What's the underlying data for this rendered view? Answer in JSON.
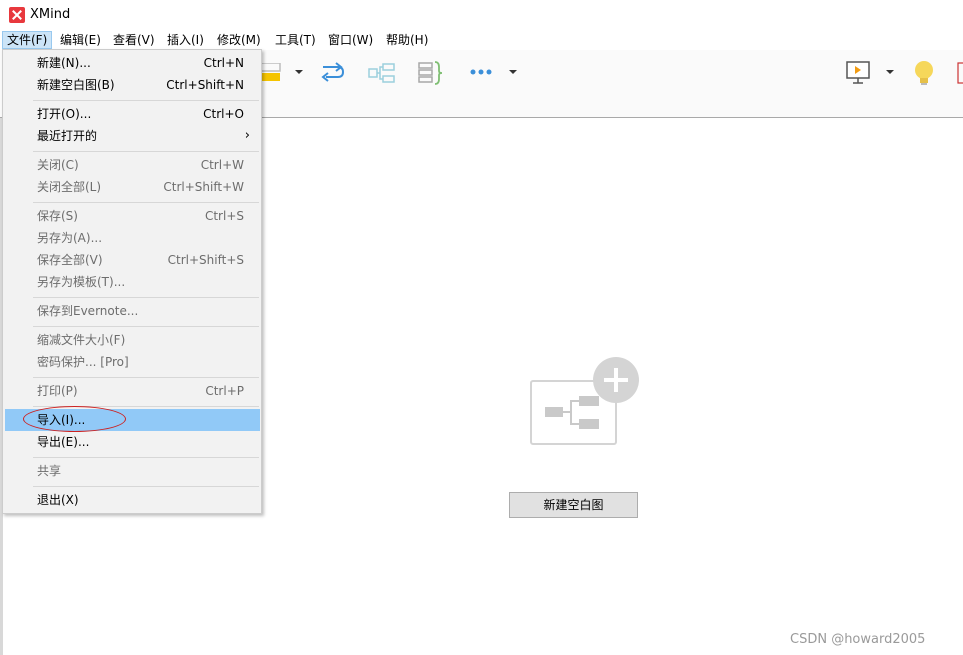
{
  "window": {
    "title": "XMind"
  },
  "menubar": [
    "文件(F)",
    "编辑(E)",
    "查看(V)",
    "插入(I)",
    "修改(M)",
    "工具(T)",
    "窗口(W)",
    "帮助(H)"
  ],
  "file_menu": {
    "items": [
      {
        "label": "新建(N)...",
        "shortcut": "Ctrl+N",
        "enabled": true
      },
      {
        "label": "新建空白图(B)",
        "shortcut": "Ctrl+Shift+N",
        "enabled": true
      },
      {
        "label": "打开(O)...",
        "shortcut": "Ctrl+O",
        "enabled": true
      },
      {
        "label": "最近打开的",
        "shortcut": "",
        "enabled": true,
        "submenu": true
      },
      {
        "label": "关闭(C)",
        "shortcut": "Ctrl+W",
        "enabled": false
      },
      {
        "label": "关闭全部(L)",
        "shortcut": "Ctrl+Shift+W",
        "enabled": false
      },
      {
        "label": "保存(S)",
        "shortcut": "Ctrl+S",
        "enabled": false
      },
      {
        "label": "另存为(A)...",
        "shortcut": "",
        "enabled": false
      },
      {
        "label": "保存全部(V)",
        "shortcut": "Ctrl+Shift+S",
        "enabled": false
      },
      {
        "label": "另存为模板(T)...",
        "shortcut": "",
        "enabled": false
      },
      {
        "label": "保存到Evernote...",
        "shortcut": "",
        "enabled": false
      },
      {
        "label": "缩减文件大小(F)",
        "shortcut": "",
        "enabled": false
      },
      {
        "label": "密码保护... [Pro]",
        "shortcut": "",
        "enabled": false
      },
      {
        "label": "打印(P)",
        "shortcut": "Ctrl+P",
        "enabled": false
      },
      {
        "label": "导入(I)...",
        "shortcut": "",
        "enabled": true,
        "highlighted": true
      },
      {
        "label": "导出(E)...",
        "shortcut": "",
        "enabled": true
      },
      {
        "label": "共享",
        "shortcut": "",
        "enabled": false
      },
      {
        "label": "退出(X)",
        "shortcut": "",
        "enabled": true
      }
    ],
    "submenu_arrow": "›"
  },
  "toolbar": {
    "icons": [
      "boundary-icon",
      "relationship-icon",
      "summary-structure-icon",
      "summary-icon",
      "more-icon",
      "presentation-icon",
      "idea-bulb-icon"
    ],
    "colors": {
      "accent": "#f5c400",
      "icon_blue": "#3b8fd9",
      "icon_green": "#7fbf73",
      "bulb": "#f6d75a",
      "presentation_orange": "#f39c12"
    }
  },
  "editor": {
    "new_blank_map_button": "新建空白图",
    "placeholder_icon": "new-map-illustration-icon"
  },
  "watermark": "CSDN @howard2005",
  "colors": {
    "highlight": "#91c9f7",
    "menu_bg": "#f2f2f2",
    "annotation": "#cc2222",
    "app_red": "#e8383d"
  }
}
